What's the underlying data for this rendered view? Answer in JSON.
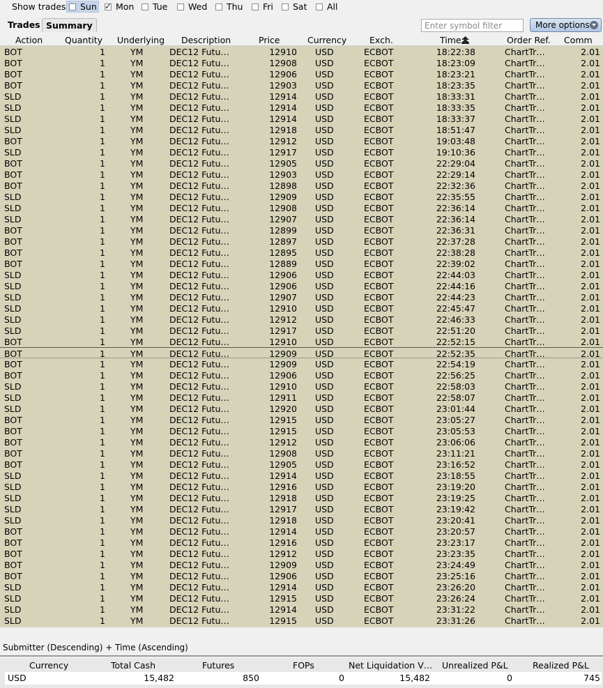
{
  "toolbar": {
    "show_trades_label": "Show trades",
    "days": [
      {
        "label": "Sun",
        "checked": false,
        "selected": true
      },
      {
        "label": "Mon",
        "checked": true,
        "selected": false
      },
      {
        "label": "Tue",
        "checked": false,
        "selected": false
      },
      {
        "label": "Wed",
        "checked": false,
        "selected": false
      },
      {
        "label": "Thu",
        "checked": false,
        "selected": false
      },
      {
        "label": "Fri",
        "checked": false,
        "selected": false
      },
      {
        "label": "Sat",
        "checked": false,
        "selected": false
      },
      {
        "label": "All",
        "checked": false,
        "selected": false
      }
    ]
  },
  "tabs": [
    {
      "label": "Trades",
      "active": false
    },
    {
      "label": "Summary",
      "active": true
    }
  ],
  "filter": {
    "placeholder": "Enter symbol filter",
    "value": ""
  },
  "more_options": {
    "label": "More options"
  },
  "columns": {
    "action": "Action",
    "quantity": "Quantity",
    "underlying": "Underlying",
    "description": "Description",
    "price": "Price",
    "currency": "Currency",
    "exchange": "Exch.",
    "time": "Time",
    "order_ref": "Order Ref.",
    "comm": "Comm"
  },
  "row_defaults": {
    "quantity": "1",
    "underlying": "YM",
    "description": "DEC12 Futu…",
    "currency": "USD",
    "exchange": "ECBOT",
    "order_ref": "ChartTr…",
    "comm": "2.01"
  },
  "selected_row": 27,
  "trades": [
    [
      "BOT",
      "12910",
      "18:22:38"
    ],
    [
      "BOT",
      "12908",
      "18:23:09"
    ],
    [
      "BOT",
      "12906",
      "18:23:21"
    ],
    [
      "BOT",
      "12903",
      "18:23:35"
    ],
    [
      "SLD",
      "12914",
      "18:33:31"
    ],
    [
      "SLD",
      "12914",
      "18:33:35"
    ],
    [
      "SLD",
      "12914",
      "18:33:37"
    ],
    [
      "SLD",
      "12918",
      "18:51:47"
    ],
    [
      "BOT",
      "12912",
      "19:03:48"
    ],
    [
      "SLD",
      "12917",
      "19:10:36"
    ],
    [
      "BOT",
      "12905",
      "22:29:04"
    ],
    [
      "BOT",
      "12903",
      "22:29:14"
    ],
    [
      "BOT",
      "12898",
      "22:32:36"
    ],
    [
      "SLD",
      "12909",
      "22:35:55"
    ],
    [
      "SLD",
      "12908",
      "22:36:14"
    ],
    [
      "SLD",
      "12907",
      "22:36:14"
    ],
    [
      "BOT",
      "12899",
      "22:36:31"
    ],
    [
      "BOT",
      "12897",
      "22:37:28"
    ],
    [
      "BOT",
      "12895",
      "22:38:28"
    ],
    [
      "BOT",
      "12889",
      "22:39:02"
    ],
    [
      "SLD",
      "12906",
      "22:44:03"
    ],
    [
      "SLD",
      "12906",
      "22:44:16"
    ],
    [
      "SLD",
      "12907",
      "22:44:23"
    ],
    [
      "SLD",
      "12910",
      "22:45:47"
    ],
    [
      "SLD",
      "12912",
      "22:46:33"
    ],
    [
      "SLD",
      "12917",
      "22:51:20"
    ],
    [
      "BOT",
      "12910",
      "22:52:15"
    ],
    [
      "BOT",
      "12909",
      "22:52:35"
    ],
    [
      "BOT",
      "12909",
      "22:54:19"
    ],
    [
      "BOT",
      "12906",
      "22:56:25"
    ],
    [
      "SLD",
      "12910",
      "22:58:03"
    ],
    [
      "SLD",
      "12911",
      "22:58:07"
    ],
    [
      "SLD",
      "12920",
      "23:01:44"
    ],
    [
      "BOT",
      "12915",
      "23:05:27"
    ],
    [
      "BOT",
      "12915",
      "23:05:53"
    ],
    [
      "BOT",
      "12912",
      "23:06:06"
    ],
    [
      "BOT",
      "12908",
      "23:11:21"
    ],
    [
      "BOT",
      "12905",
      "23:16:52"
    ],
    [
      "SLD",
      "12914",
      "23:18:55"
    ],
    [
      "SLD",
      "12916",
      "23:19:20"
    ],
    [
      "SLD",
      "12918",
      "23:19:25"
    ],
    [
      "SLD",
      "12917",
      "23:19:42"
    ],
    [
      "SLD",
      "12918",
      "23:20:41"
    ],
    [
      "BOT",
      "12914",
      "23:20:57"
    ],
    [
      "BOT",
      "12916",
      "23:23:17"
    ],
    [
      "BOT",
      "12912",
      "23:23:35"
    ],
    [
      "BOT",
      "12909",
      "23:24:49"
    ],
    [
      "BOT",
      "12906",
      "23:25:16"
    ],
    [
      "SLD",
      "12914",
      "23:26:20"
    ],
    [
      "SLD",
      "12915",
      "23:26:24"
    ],
    [
      "SLD",
      "12914",
      "23:31:22"
    ],
    [
      "SLD",
      "12915",
      "23:31:26"
    ]
  ],
  "sort_text": "Submitter (Descending)  +  Time (Ascending)",
  "summary": {
    "headers": {
      "currency": "Currency",
      "total_cash": "Total Cash",
      "futures": "Futures",
      "fops": "FOPs",
      "net_liq": "Net Liquidation V…",
      "unrealized": "Unrealized P&L",
      "realized": "Realized P&L"
    },
    "values": {
      "currency": "USD",
      "total_cash": "15,482",
      "futures": "850",
      "fops": "0",
      "net_liq": "15,482",
      "unrealized": "0",
      "realized": "745"
    }
  }
}
